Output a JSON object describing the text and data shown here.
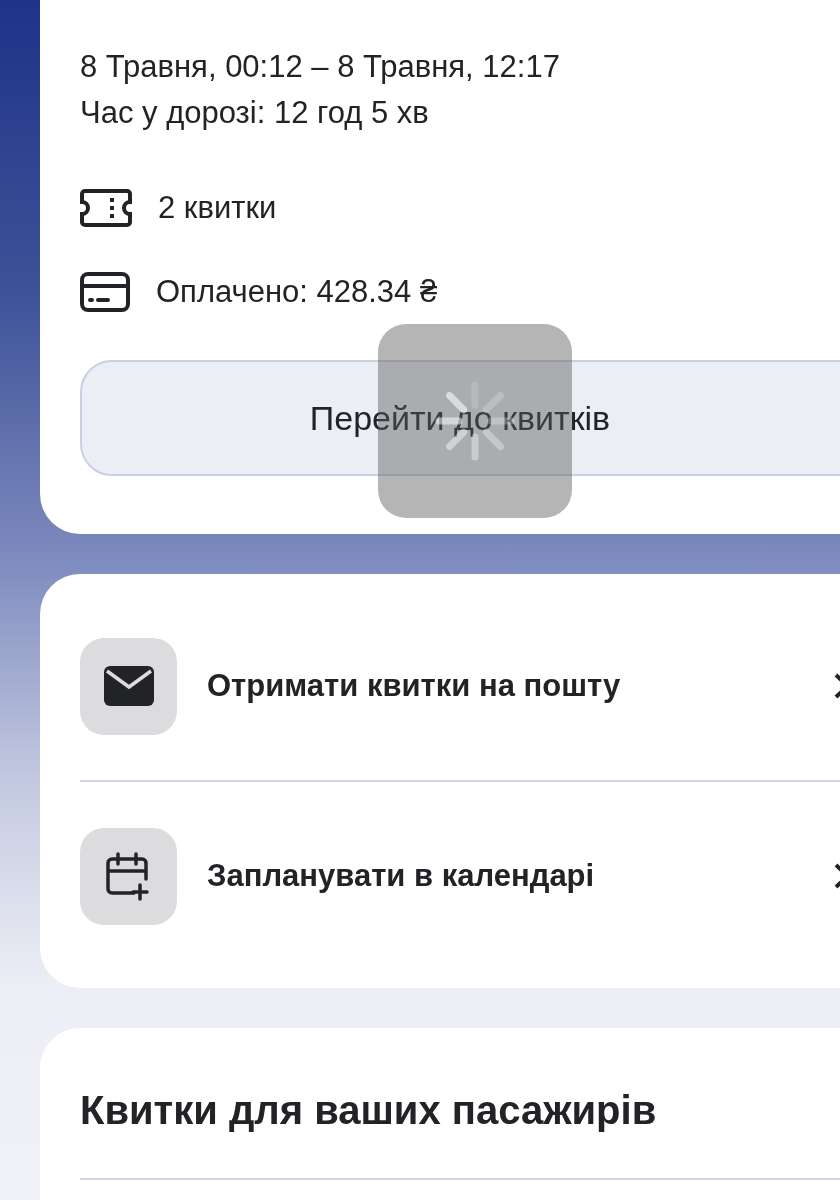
{
  "trip": {
    "time_range": "8 Травня, 00:12 – 8 Травня, 12:17",
    "duration": "Час у дорозі: 12 год 5 хв",
    "details": [
      {
        "kind": "tickets",
        "text": "2 квитки"
      },
      {
        "kind": "payment",
        "text": "Оплачено: 428.34 ₴"
      }
    ],
    "button": "Перейти до квитків"
  },
  "loading": true,
  "actions": [
    {
      "kind": "email",
      "label": "Отримати квитки на пошту"
    },
    {
      "kind": "calendar",
      "label": "Запланувати в календарі"
    }
  ],
  "passengers": {
    "title": "Квитки для ваших пасажирів"
  }
}
